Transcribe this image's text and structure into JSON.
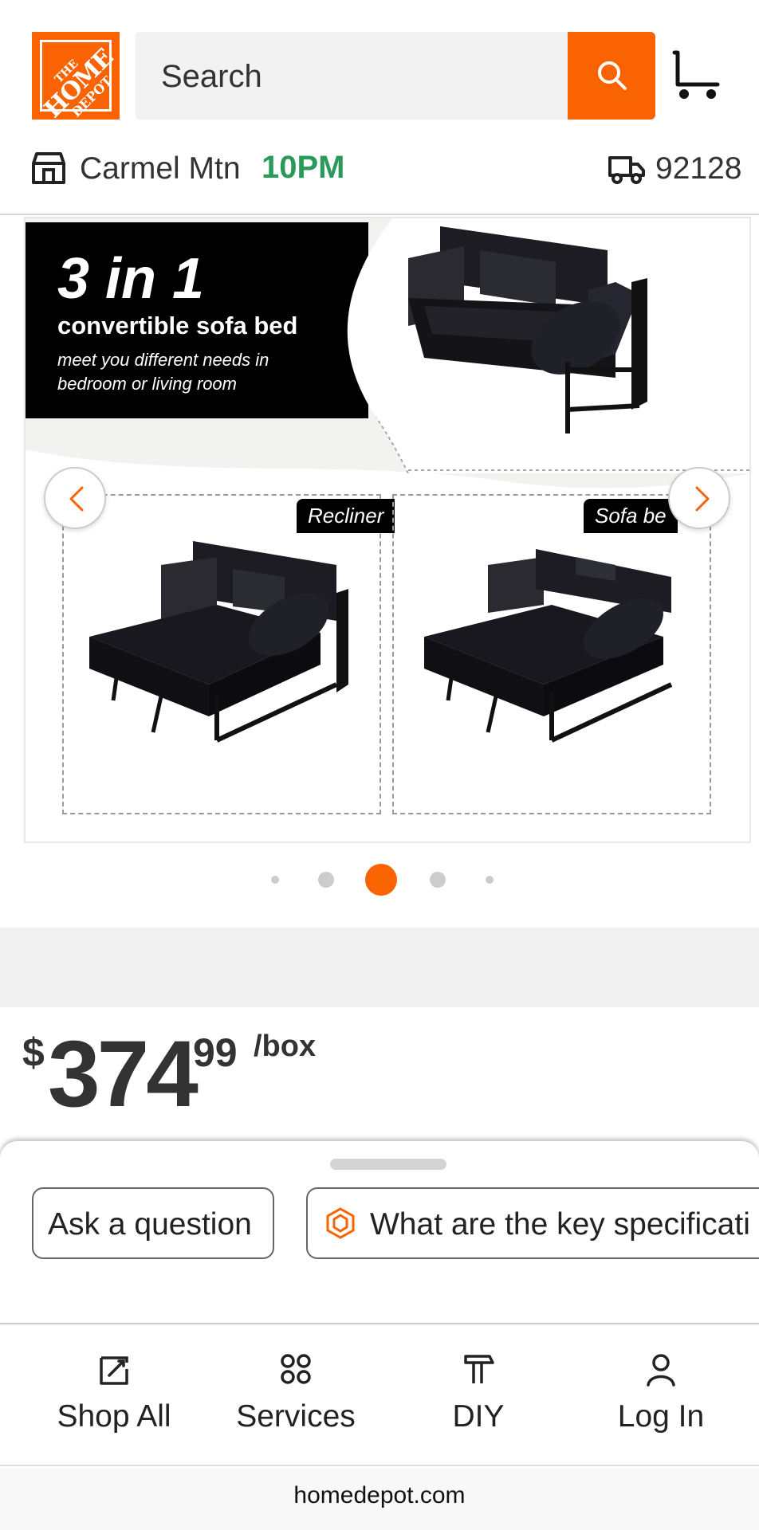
{
  "header": {
    "logo_lines": [
      "THE",
      "HOME",
      "DEPOT"
    ],
    "search_placeholder": "Search",
    "brand_color": "#f96302"
  },
  "store": {
    "name": "Carmel Mtn",
    "hours": "10PM",
    "zip": "92128"
  },
  "product_image": {
    "headline": "3 in 1",
    "subheadline": "convertible sofa bed",
    "tagline": "meet you different needs in bedroom or living room",
    "tag_left": "Recliner",
    "tag_right": "Sofa be",
    "carousel_count": 5,
    "carousel_active": 3
  },
  "price": {
    "currency": "$",
    "dollars": "374",
    "cents": "99",
    "unit": "/box"
  },
  "sheet": {
    "chips": [
      "Ask a question",
      "What are the key specificati"
    ]
  },
  "bottom_nav": {
    "items": [
      "Shop All",
      "Services",
      "DIY",
      "Log In"
    ]
  },
  "browser": {
    "url": "homedepot.com"
  }
}
